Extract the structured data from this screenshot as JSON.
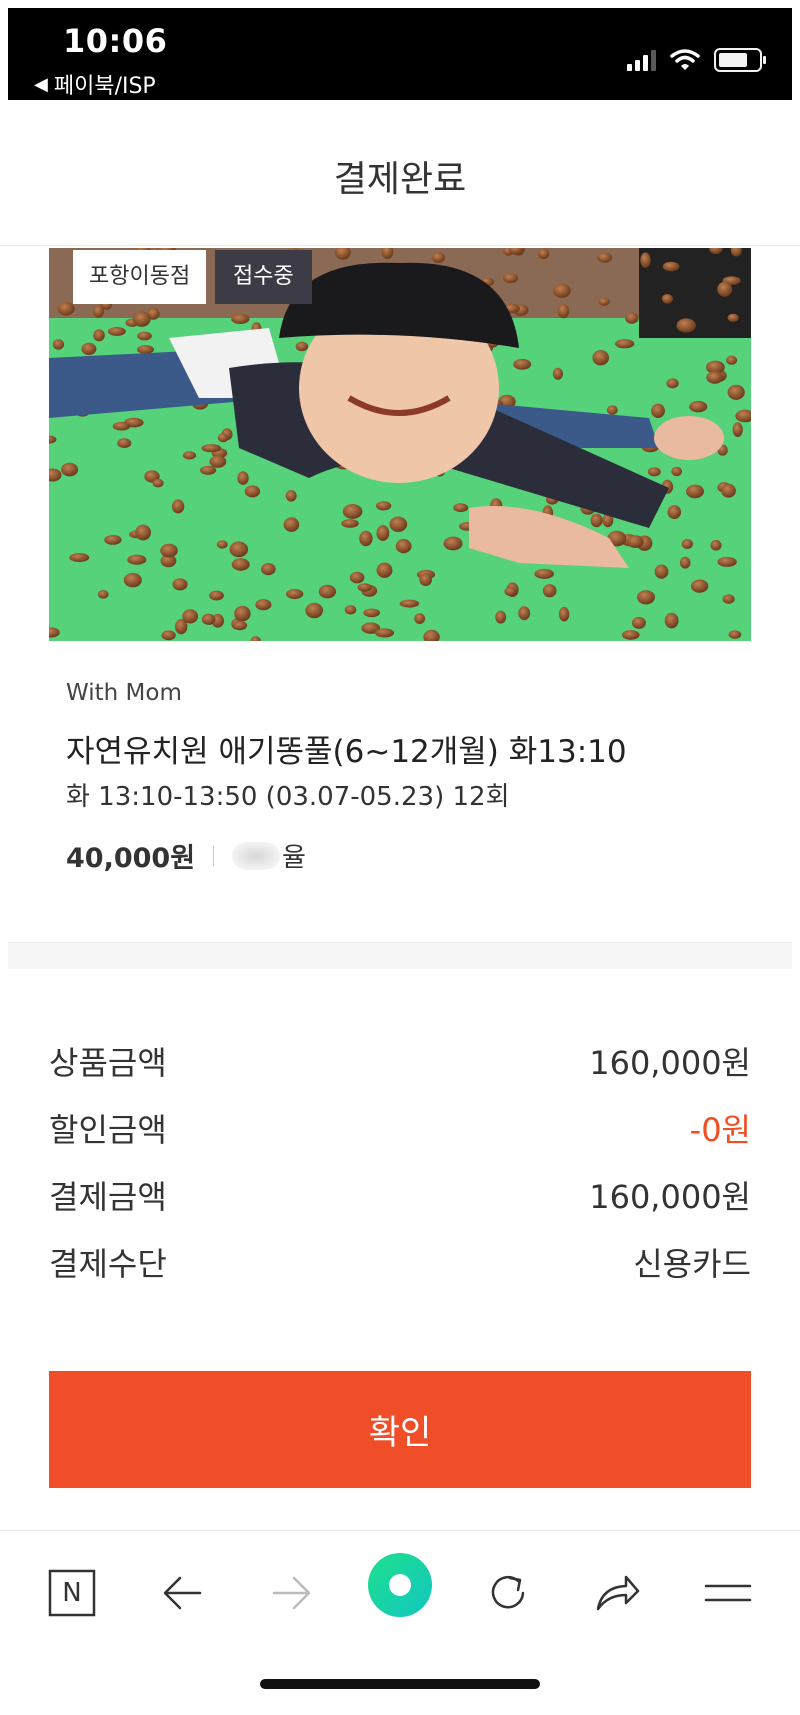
{
  "status_bar": {
    "time": "10:06",
    "back_app": "페이북/ISP"
  },
  "header": {
    "title": "결제완료"
  },
  "product": {
    "branch_tag": "포항이동점",
    "status_tag": "접수중",
    "category": "With Mom",
    "title": "자연유치원 애기똥풀(6~12개월) 화13:10",
    "schedule": "화 13:10-13:50 (03.07-05.23) 12회",
    "price": "40,000원",
    "teacher_suffix": "율"
  },
  "summary": {
    "rows": [
      {
        "label": "상품금액",
        "value": "160,000원"
      },
      {
        "label": "할인금액",
        "value": "-0원"
      },
      {
        "label": "결제금액",
        "value": "160,000원"
      },
      {
        "label": "결제수단",
        "value": "신용카드"
      }
    ]
  },
  "confirm_label": "확인",
  "colors": {
    "accent": "#f04e29",
    "discount": "#f04e23",
    "status_tag_bg": "#3d3b45",
    "home_button": "#1ad6a0"
  },
  "bottom_bar": {
    "icons": [
      "naver-n-icon",
      "back-arrow-icon",
      "forward-arrow-icon",
      "home-circle-icon",
      "refresh-icon",
      "share-icon",
      "menu-icon"
    ],
    "naver_letter": "N"
  }
}
